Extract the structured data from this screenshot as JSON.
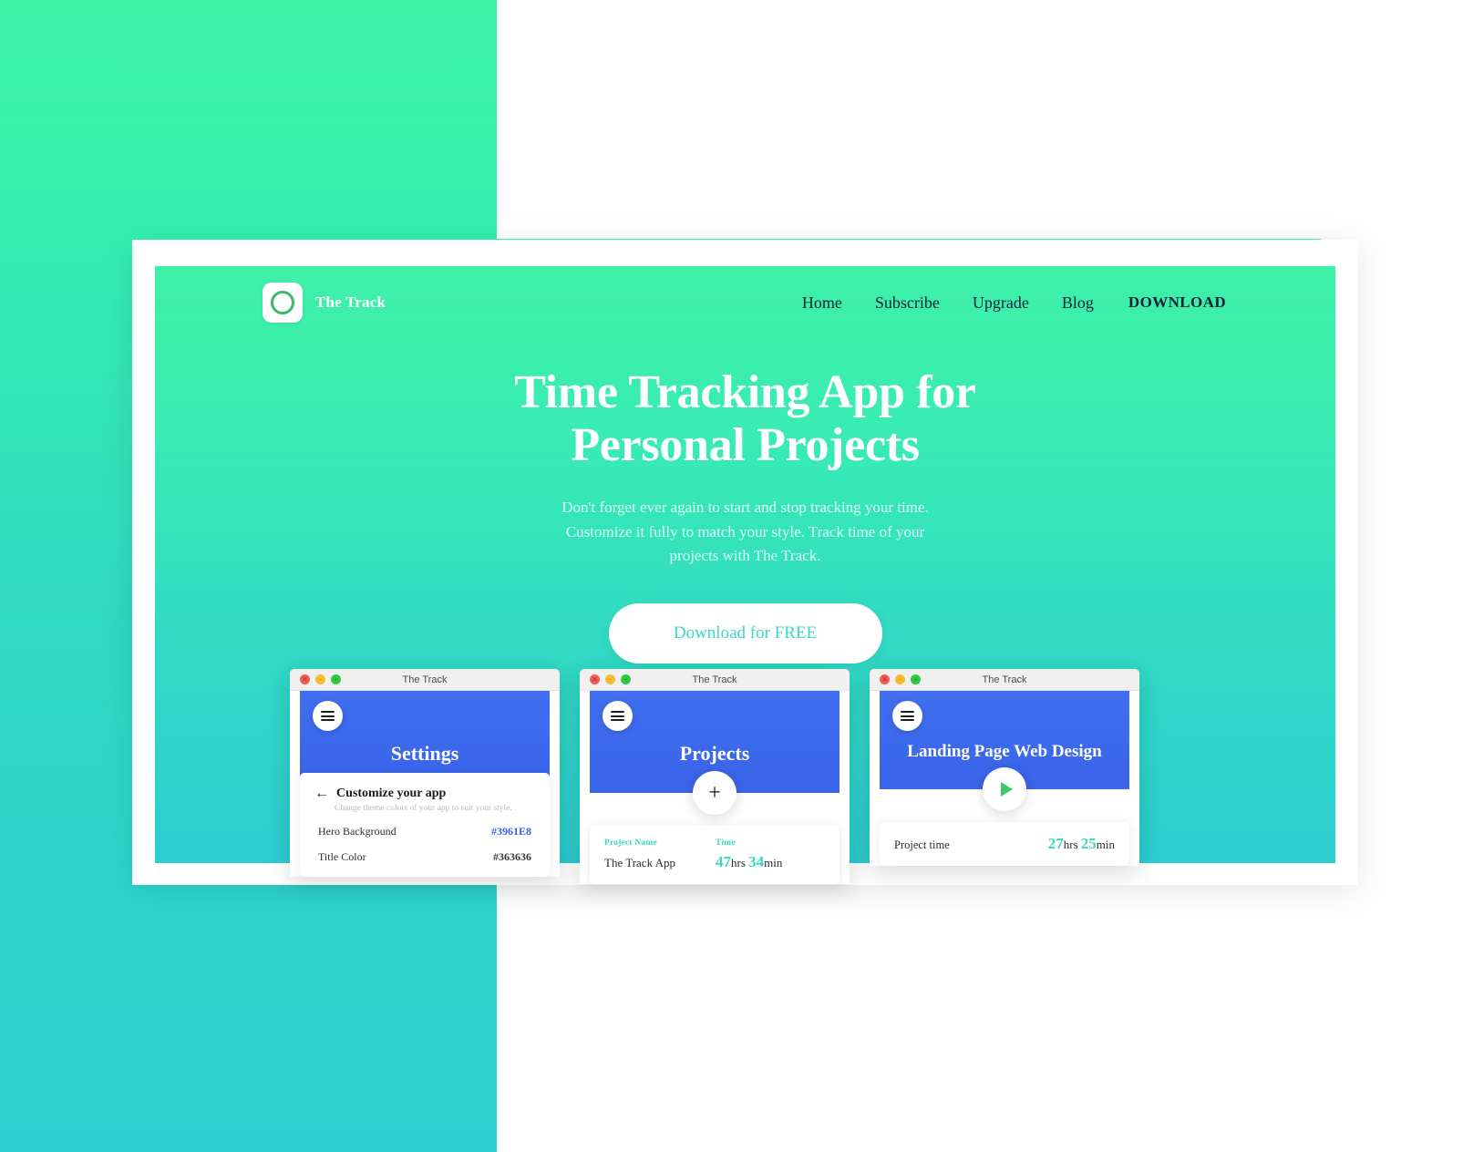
{
  "brand": {
    "name": "The Track",
    "logo_icon": "circle-ring-logo-icon"
  },
  "nav": {
    "links": [
      {
        "label": "Home"
      },
      {
        "label": "Subscribe"
      },
      {
        "label": "Upgrade"
      },
      {
        "label": "Blog"
      }
    ],
    "download_label": "DOWNLOAD",
    "highlight_color": "#FBAE3C"
  },
  "hero": {
    "title_line1": "Time Tracking App for",
    "title_line2": "Personal Projects",
    "subtitle": "Don't forget ever again to start and stop tracking your time. Customize it fully to match your style. Track time of your projects with The Track.",
    "cta_label": "Download for FREE",
    "cta_text_color": "#3ad8c4",
    "gradient_from": "#3ef0a6",
    "gradient_to": "#2ccdd1"
  },
  "windows": [
    {
      "title_bar": "The Track",
      "menu_icon": "hamburger-menu-icon",
      "screen_title": "Settings",
      "card": {
        "back_icon": "back-arrow-icon",
        "heading": "Customize your app",
        "subheading": "Change theme colors of your app to suit your style.",
        "rows": [
          {
            "label": "Hero Background",
            "value": "#3961E8",
            "value_style": "accent"
          },
          {
            "label": "Title Color",
            "value": "#363636",
            "value_style": "dark"
          }
        ]
      }
    },
    {
      "title_bar": "The Track",
      "menu_icon": "hamburger-menu-icon",
      "screen_title": "Projects",
      "action_icon": "plus-icon",
      "action_label": "+",
      "table": {
        "headers": [
          "Project Name",
          "Time"
        ],
        "rows": [
          {
            "name": "The Track App",
            "time_value": "47",
            "time_unit": "hrs",
            "time_value2": "34",
            "time_unit2": "min"
          }
        ]
      }
    },
    {
      "title_bar": "The Track",
      "menu_icon": "hamburger-menu-icon",
      "screen_title": "Landing Page Web Design",
      "action_icon": "play-icon",
      "detail": {
        "label": "Project time",
        "value": "27",
        "unit": "hrs",
        "value2": "25",
        "unit2": "min"
      }
    }
  ]
}
